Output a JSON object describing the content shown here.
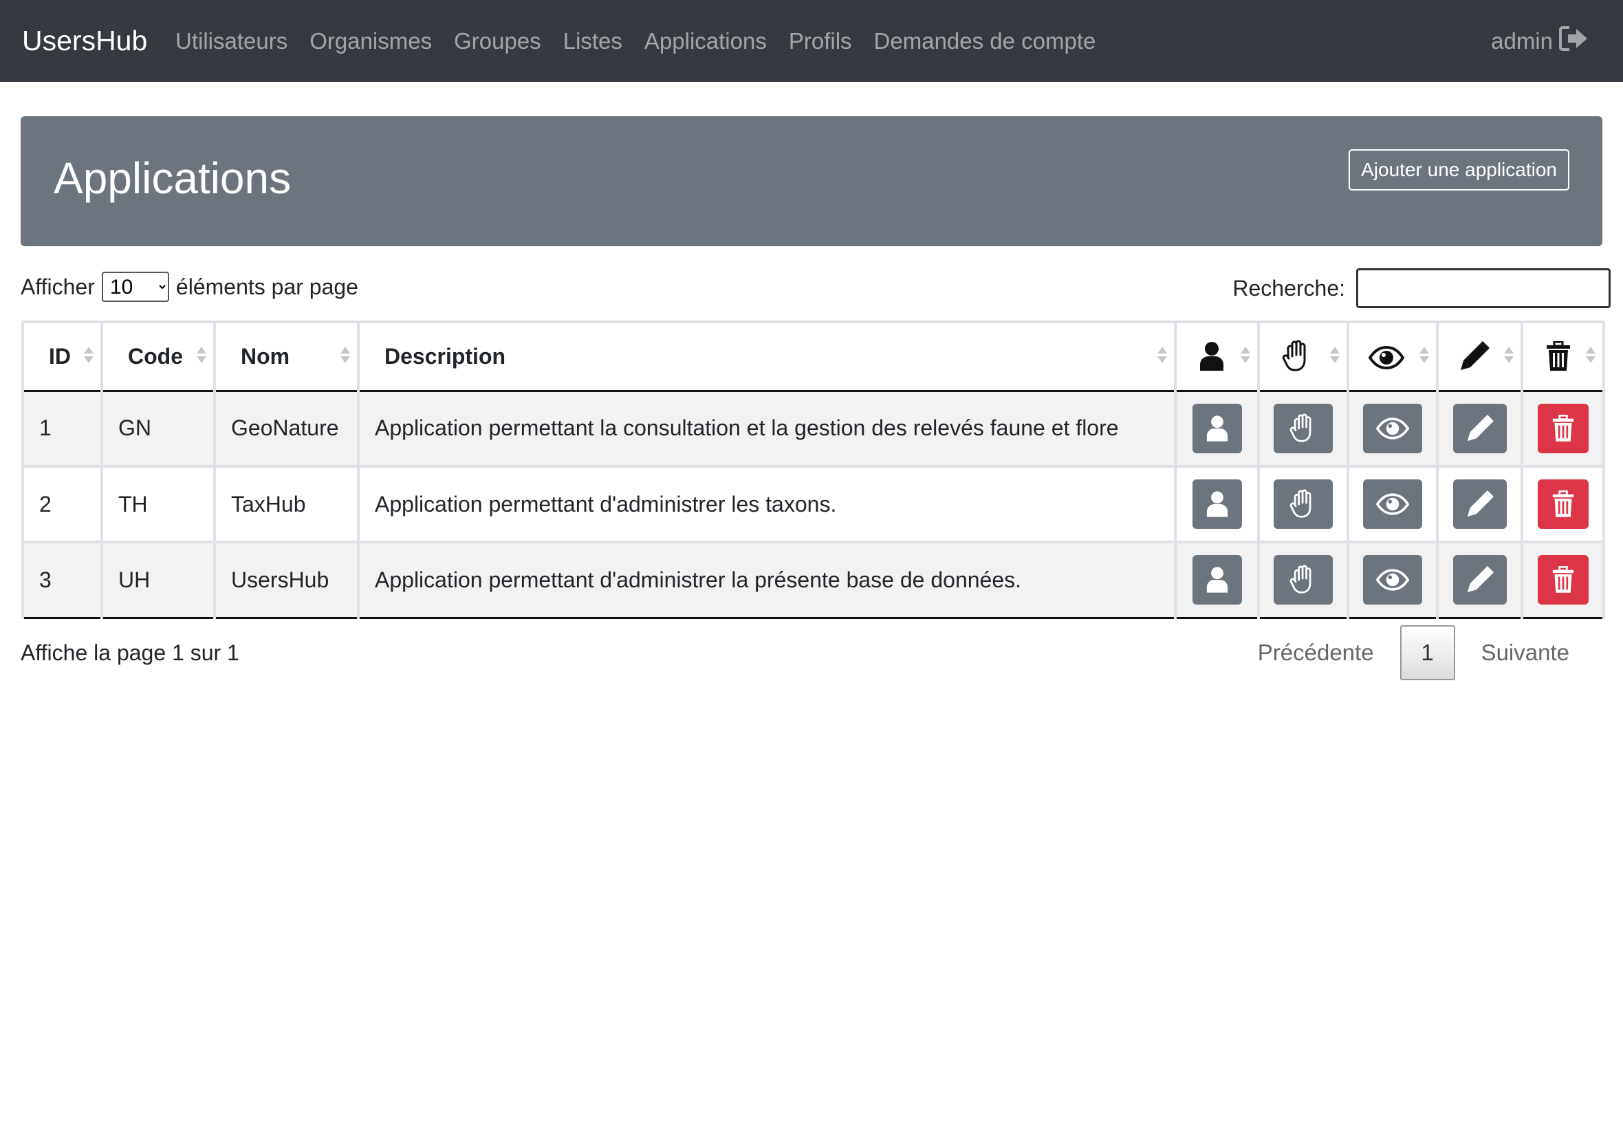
{
  "navbar": {
    "brand": "UsersHub",
    "links": [
      {
        "label": "Utilisateurs"
      },
      {
        "label": "Organismes"
      },
      {
        "label": "Groupes"
      },
      {
        "label": "Listes"
      },
      {
        "label": "Applications"
      },
      {
        "label": "Profils"
      },
      {
        "label": "Demandes de compte"
      }
    ],
    "user": "admin",
    "logout_icon": "logout-icon"
  },
  "header": {
    "title": "Applications",
    "add_button": "Ajouter une application"
  },
  "controls": {
    "show_prefix": "Afficher",
    "page_length": "10",
    "page_length_options": [
      "10"
    ],
    "show_suffix": "éléments par page",
    "search_label": "Recherche:",
    "search_value": ""
  },
  "table": {
    "columns": {
      "id": "ID",
      "code": "Code",
      "nom": "Nom",
      "description": "Description",
      "icons": [
        "user-icon",
        "hand-icon",
        "eye-icon",
        "pencil-icon",
        "trash-icon"
      ]
    },
    "rows": [
      {
        "id": "1",
        "code": "GN",
        "nom": "GeoNature",
        "description": "Application permettant la consultation et la gestion des relevés faune et flore"
      },
      {
        "id": "2",
        "code": "TH",
        "nom": "TaxHub",
        "description": "Application permettant d'administrer les taxons."
      },
      {
        "id": "3",
        "code": "UH",
        "nom": "UsersHub",
        "description": "Application permettant d'administrer la présente base de données."
      }
    ]
  },
  "footer": {
    "info": "Affiche la page 1 sur 1",
    "prev": "Précédente",
    "current_page": "1",
    "next": "Suivante"
  },
  "colors": {
    "navbar": "#343a40",
    "header": "#6c757d",
    "action_button": "#6c757d",
    "delete_button": "#dc3545",
    "row_stripe": "#f2f2f2"
  }
}
